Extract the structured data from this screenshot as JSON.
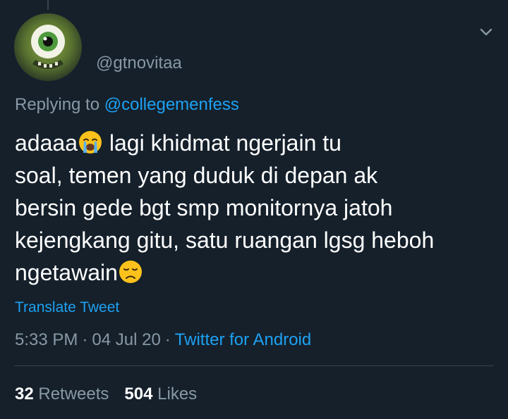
{
  "author": {
    "handle": "@gtnovitaa",
    "avatar_icon": "avatar-image"
  },
  "header": {
    "menu_icon": "chevron-down-icon"
  },
  "reply": {
    "prefix": "Replying to",
    "mention": "@collegemenfess"
  },
  "tweet": {
    "line1_a": "adaaa",
    "line1_emoji": "crying-face-emoji",
    "line1_b": " lagi khidmat ngerjain tu",
    "line2": "soal, temen yang duduk di depan ak",
    "line3": "bersin gede bgt smp monitornya jatoh",
    "line4": "kejengkang gitu, satu ruangan lgsg heboh",
    "line5": "ngetawain",
    "line5_emoji": "disappointed-face-emoji"
  },
  "translate": {
    "label": "Translate Tweet"
  },
  "meta": {
    "time": "5:33 PM",
    "separator": "·",
    "date": "04 Jul 20",
    "source": "Twitter for Android"
  },
  "stats": {
    "retweets_count": "32",
    "retweets_label": "Retweets",
    "likes_count": "504",
    "likes_label": "Likes"
  },
  "colors": {
    "background": "#15202b",
    "text": "#ffffff",
    "secondary": "#8899a6",
    "accent": "#1da1f2",
    "divider": "#38444d"
  }
}
